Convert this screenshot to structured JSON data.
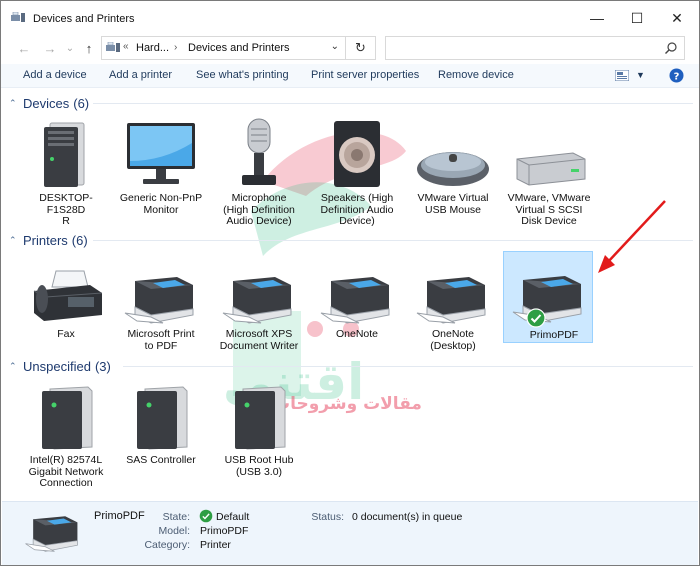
{
  "window": {
    "title": "Devices and Printers",
    "controls": {
      "minimize": "—",
      "maximize": "☐",
      "close": "✕"
    }
  },
  "address": {
    "overflow": "«",
    "crumbs": [
      "Hard...",
      "Devices and Printers"
    ],
    "separator": "›",
    "dropdown": "⌄",
    "refresh": "↻",
    "search_placeholder": ""
  },
  "commands": [
    "Add a device",
    "Add a printer",
    "See what's printing",
    "Print server properties",
    "Remove device"
  ],
  "groups": {
    "devices": {
      "title": "Devices",
      "count": "(6)",
      "items": [
        {
          "label": "DESKTOP-F1S28D\nR",
          "icon": "computer-tower-icon"
        },
        {
          "label": "Generic Non-PnP\nMonitor",
          "icon": "monitor-icon"
        },
        {
          "label": "Microphone\n(High Definition\nAudio Device)",
          "icon": "microphone-icon"
        },
        {
          "label": "Speakers (High\nDefinition Audio\nDevice)",
          "icon": "speaker-icon"
        },
        {
          "label": "VMware Virtual\nUSB Mouse",
          "icon": "mouse-icon"
        },
        {
          "label": "VMware, VMware\nVirtual S SCSI\nDisk Device",
          "icon": "disk-drive-icon"
        }
      ]
    },
    "printers": {
      "title": "Printers",
      "count": "(6)",
      "items": [
        {
          "label": "Fax",
          "icon": "fax-icon"
        },
        {
          "label": "Microsoft Print\nto PDF",
          "icon": "printer-icon"
        },
        {
          "label": "Microsoft XPS\nDocument Writer",
          "icon": "printer-icon"
        },
        {
          "label": "OneNote",
          "icon": "printer-icon"
        },
        {
          "label": "OneNote\n(Desktop)",
          "icon": "printer-icon"
        },
        {
          "label": "PrimoPDF",
          "icon": "printer-default-icon",
          "selected": true
        }
      ]
    },
    "unspecified": {
      "title": "Unspecified",
      "count": "(3)",
      "items": [
        {
          "label": "Intel(R) 82574L\nGigabit Network\nConnection",
          "icon": "device-box-icon"
        },
        {
          "label": "SAS Controller",
          "icon": "device-box-icon"
        },
        {
          "label": "USB Root Hub\n(USB 3.0)",
          "icon": "device-box-icon"
        }
      ]
    }
  },
  "details": {
    "name": "PrimoPDF",
    "state_label": "State:",
    "state_value": "Default",
    "model_label": "Model:",
    "model_value": "PrimoPDF",
    "category_label": "Category:",
    "category_value": "Printer",
    "status_label": "Status:",
    "status_value": "0 document(s) in queue"
  },
  "watermark": {
    "main": "اقتنی",
    "sub": "مقالات وشروحات"
  },
  "colors": {
    "accent_text": "#1e395b",
    "selection_fill": "#cce8ff",
    "selection_border": "#99d1ff",
    "default_check": "#2e9e44",
    "arrow": "#e21b1b",
    "watermark_green": "#3cc08c",
    "watermark_red": "#e8506a"
  }
}
